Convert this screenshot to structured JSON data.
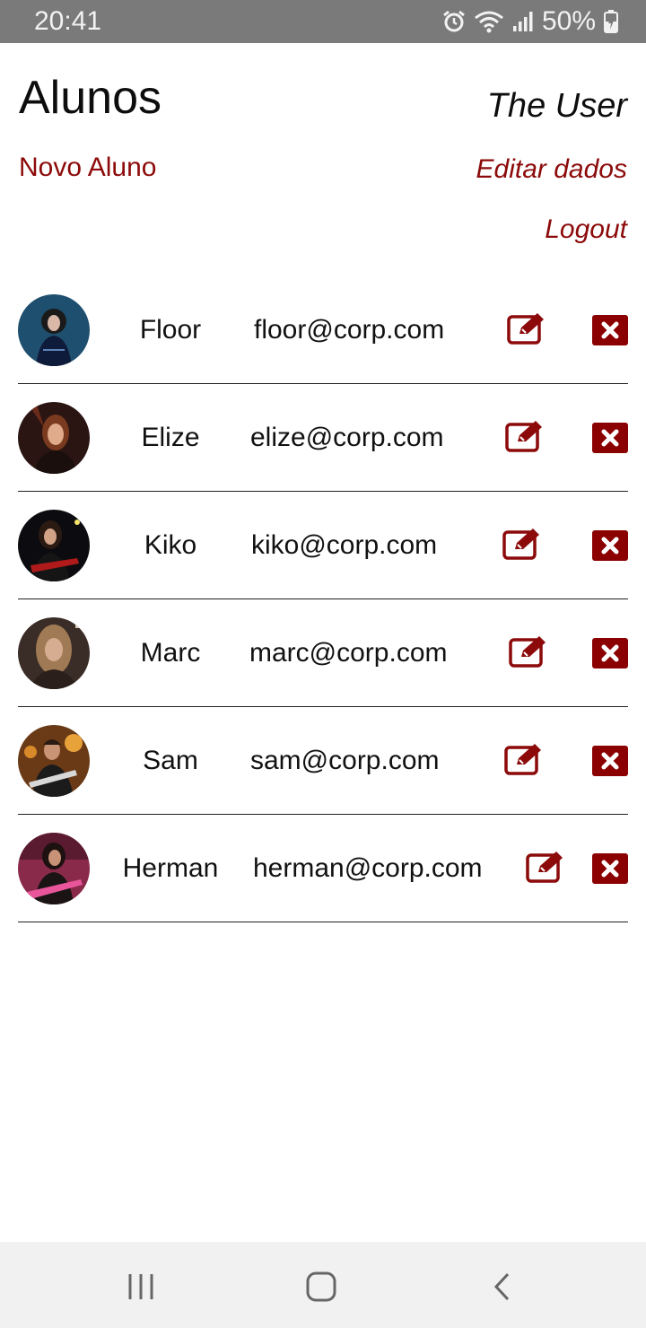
{
  "status_bar": {
    "time": "20:41",
    "battery": "50%",
    "icons": [
      "alarm-icon",
      "wifi-icon",
      "signal-icon",
      "battery-charging-icon"
    ]
  },
  "header": {
    "title": "Alunos",
    "user": "The User",
    "new_student": "Novo Aluno",
    "edit_data": "Editar dados",
    "logout": "Logout"
  },
  "colors": {
    "accent": "#8c0a0a",
    "delete_bg": "#8b0000"
  },
  "students": [
    {
      "name": "Floor",
      "email": "floor@corp.com",
      "photo": "avatar-floor"
    },
    {
      "name": "Elize",
      "email": "elize@corp.com",
      "photo": "avatar-elize"
    },
    {
      "name": "Kiko",
      "email": "kiko@corp.com",
      "photo": "avatar-kiko"
    },
    {
      "name": "Marc",
      "email": "marc@corp.com",
      "photo": "avatar-marc"
    },
    {
      "name": "Sam",
      "email": "sam@corp.com",
      "photo": "avatar-sam"
    },
    {
      "name": "Herman",
      "email": "herman@corp.com",
      "photo": "avatar-herman"
    }
  ],
  "row_icons": {
    "edit": "edit-icon",
    "delete": "delete-icon"
  },
  "nav_bar": {
    "icons": [
      "recents-icon",
      "home-icon",
      "back-icon"
    ]
  }
}
